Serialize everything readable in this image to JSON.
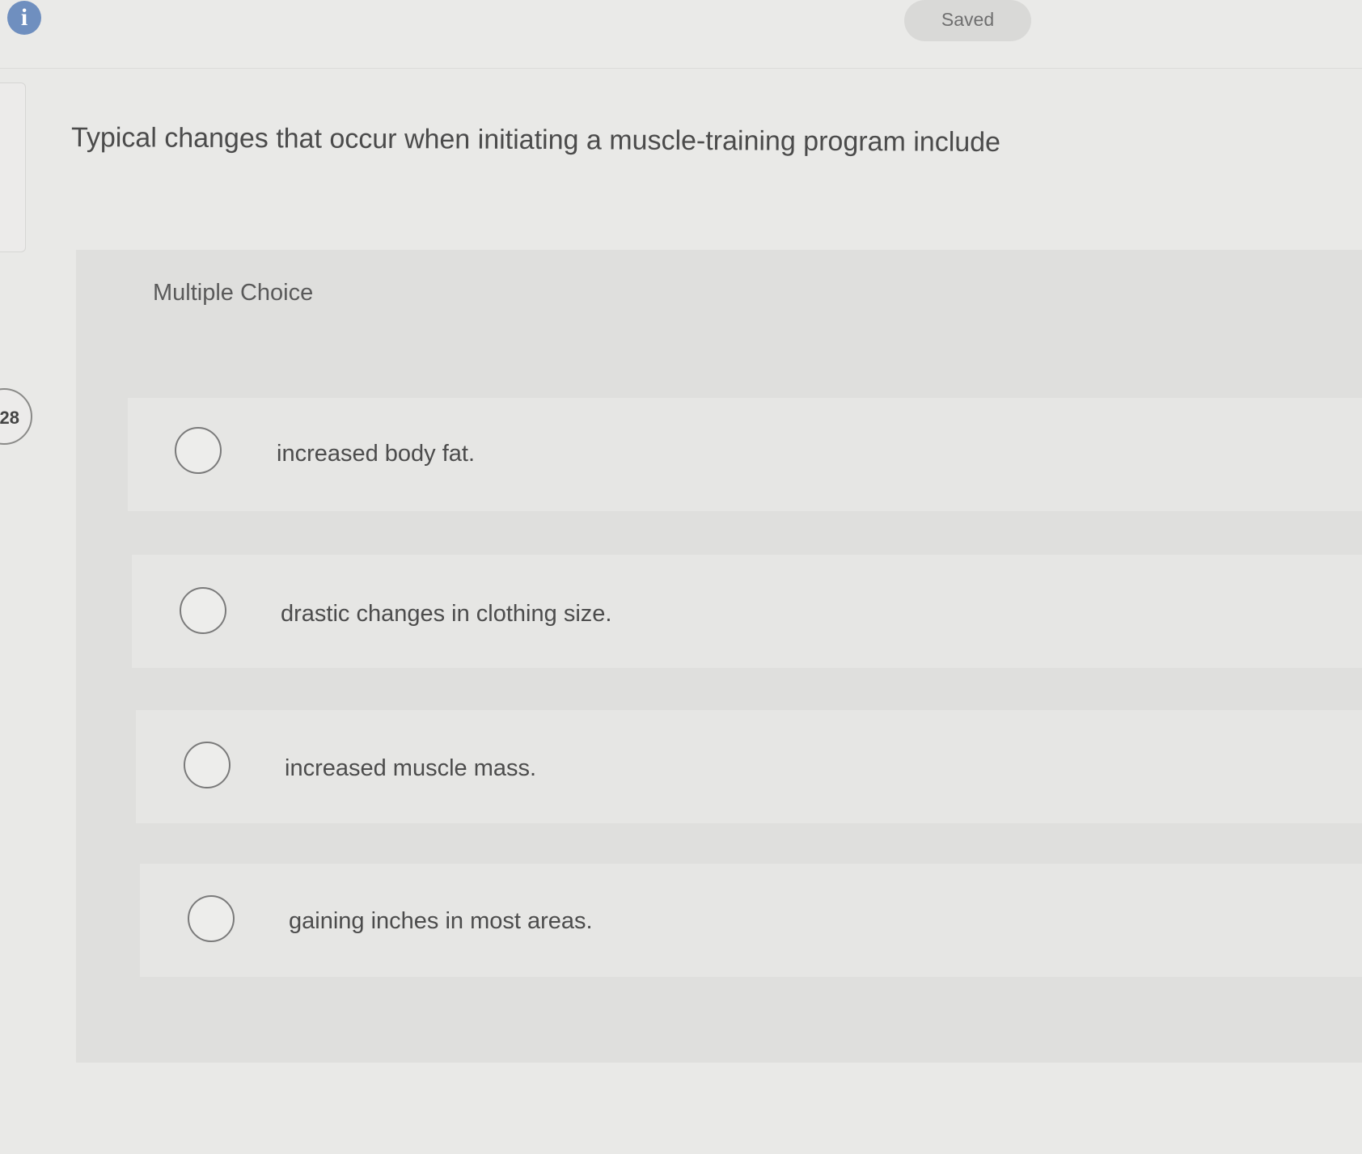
{
  "header": {
    "info_icon": "info-icon",
    "status": "Saved"
  },
  "question": {
    "number": "28",
    "text": "Typical changes that occur when initiating a muscle-training program include",
    "type_label": "Multiple Choice",
    "options": [
      {
        "label": "increased body fat."
      },
      {
        "label": "drastic changes in clothing size."
      },
      {
        "label": "increased muscle mass."
      },
      {
        "label": "gaining inches in most areas."
      }
    ]
  }
}
